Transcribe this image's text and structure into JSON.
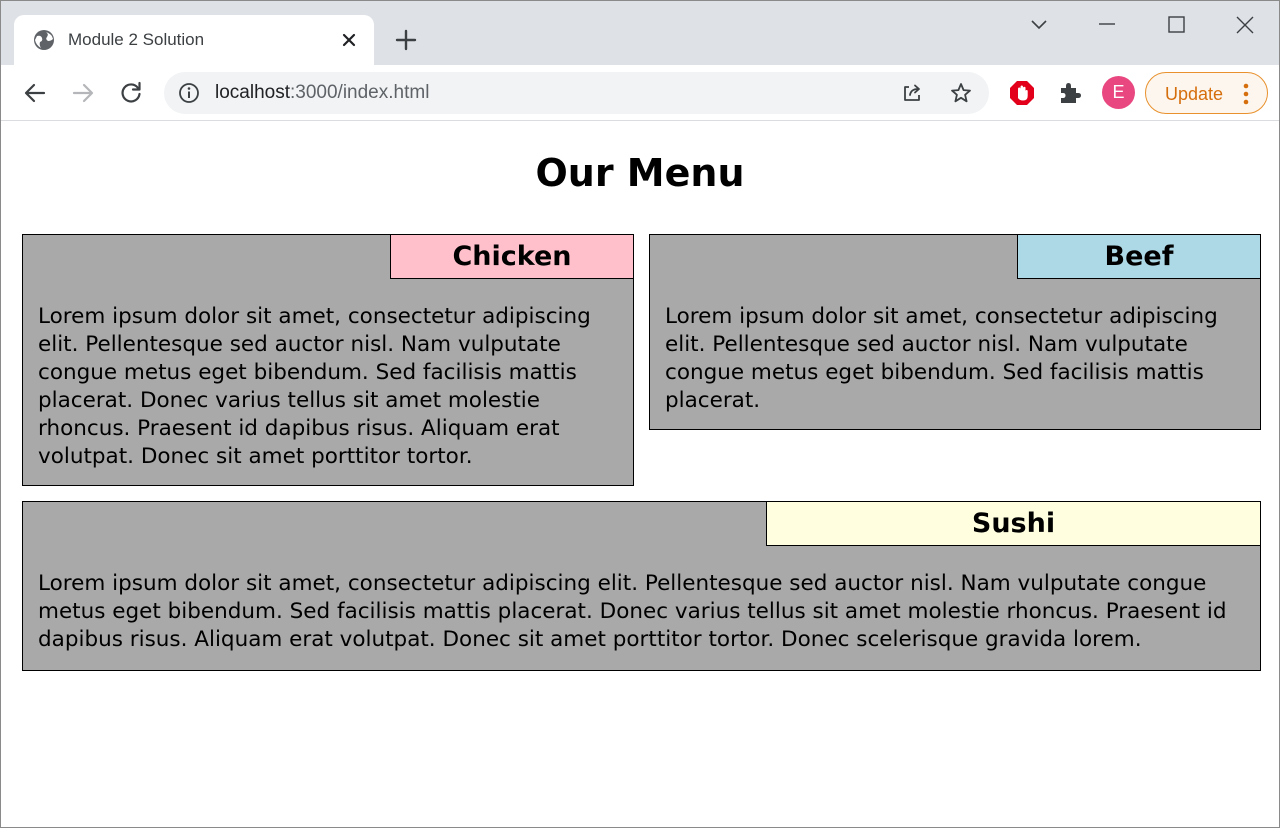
{
  "browser": {
    "tab": {
      "title": "Module 2 Solution",
      "favicon": "globe-icon"
    },
    "address": {
      "host": "localhost",
      "rest": ":3000/index.html"
    },
    "profile_initial": "E",
    "update_label": "Update",
    "icons": [
      "back-arrow-icon",
      "forward-arrow-icon",
      "reload-icon",
      "info-icon",
      "share-icon",
      "star-icon",
      "adblock-icon",
      "extensions-puzzle-icon",
      "kebab-menu-icon",
      "tab-search-icon",
      "minimize-icon",
      "maximize-icon",
      "close-window-icon",
      "new-tab-plus-icon",
      "close-tab-icon"
    ],
    "colors": {
      "tabstrip": "#dee1e6",
      "update_accent": "#e8912d",
      "avatar": "#e8477f",
      "adblock": "#e2001a"
    }
  },
  "page": {
    "title": "Our Menu",
    "cards": [
      {
        "id": "chicken",
        "label": "Chicken",
        "label_color": "#ffc0cb",
        "text": "Lorem ipsum dolor sit amet, consectetur adipiscing elit. Pellentesque sed auctor nisl. Nam vulputate congue metus eget bibendum. Sed facilisis mattis placerat. Donec varius tellus sit amet molestie rhoncus. Praesent id dapibus risus. Aliquam erat volutpat. Donec sit amet porttitor tortor."
      },
      {
        "id": "beef",
        "label": "Beef",
        "label_color": "#add8e6",
        "text": "Lorem ipsum dolor sit amet, consectetur adipiscing elit. Pellentesque sed auctor nisl. Nam vulputate congue metus eget bibendum. Sed facilisis mattis placerat."
      },
      {
        "id": "sushi",
        "label": "Sushi",
        "label_color": "#ffffe0",
        "text": "Lorem ipsum dolor sit amet, consectetur adipiscing elit. Pellentesque sed auctor nisl. Nam vulputate congue metus eget bibendum. Sed facilisis mattis placerat. Donec varius tellus sit amet molestie rhoncus. Praesent id dapibus risus. Aliquam erat volutpat. Donec sit amet porttitor tortor. Donec scelerisque gravida lorem."
      }
    ],
    "card_background": "#a9a9a9"
  }
}
